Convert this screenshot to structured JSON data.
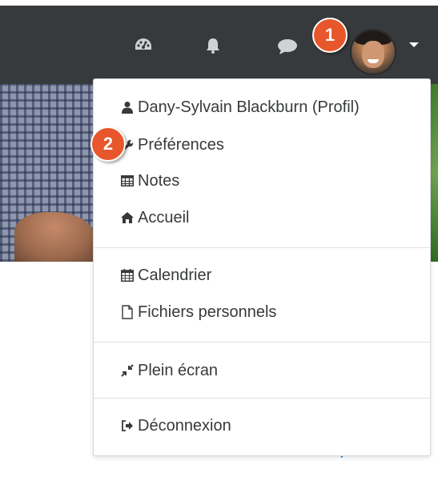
{
  "navbar": {
    "icons": [
      "dashboard-icon",
      "bell-icon",
      "chat-icon"
    ],
    "user_menu_caret": "chevron-down-icon"
  },
  "callouts": {
    "one": "1",
    "two": "2"
  },
  "background": {
    "partial_link": "Tout déplier"
  },
  "menu": {
    "profile": {
      "label": "Dany-Sylvain Blackburn (Profil)",
      "icon": "user-icon"
    },
    "preferences": {
      "label": "Préférences",
      "icon": "wrench-icon"
    },
    "notes": {
      "label": "Notes",
      "icon": "table-icon"
    },
    "home": {
      "label": "Accueil",
      "icon": "home-icon"
    },
    "calendar": {
      "label": "Calendrier",
      "icon": "calendar-icon"
    },
    "files": {
      "label": "Fichiers personnels",
      "icon": "file-icon"
    },
    "fullscreen": {
      "label": "Plein écran",
      "icon": "compress-icon"
    },
    "logout": {
      "label": "Déconnexion",
      "icon": "sign-out-icon"
    }
  },
  "colors": {
    "navbar": "#373a3c",
    "callout": "#e8562b",
    "link": "#0f6fc5",
    "menu_text": "#373a3c"
  }
}
